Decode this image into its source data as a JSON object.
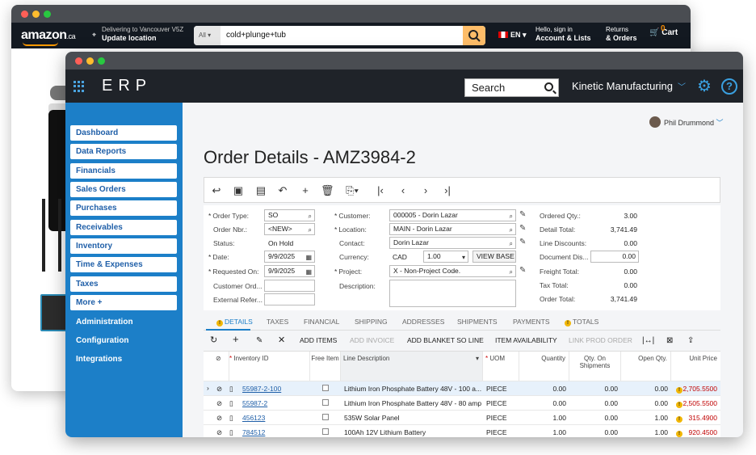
{
  "amazon": {
    "logo": "amazon",
    "logo_suffix": ".ca",
    "deliver_line1": "Delivering to Vancouver V5Z",
    "deliver_line2": "Update location",
    "search_scope": "All",
    "search_query": "cold+plunge+tub",
    "language": "EN",
    "account_line1": "Hello, sign in",
    "account_line2": "Account & Lists",
    "orders_line1": "Returns",
    "orders_line2": "& Orders",
    "cart_count": "0",
    "cart_label": "Cart"
  },
  "erp": {
    "brand": "ERP",
    "search_placeholder": "Search",
    "company": "Kinetic Manufacturing",
    "user": "Phil Drummond",
    "page_title": "Order Details - AMZ3984-2",
    "nav": [
      "Dashboard",
      "Data Reports",
      "Financials",
      "Sales Orders",
      "Purchases",
      "Receivables",
      "Inventory",
      "Time & Expenses",
      "Taxes",
      "More +"
    ],
    "nav_plain": [
      "Administration",
      "Configuration",
      "Integrations"
    ],
    "form": {
      "order_type_label": "Order Type:",
      "order_type": "SO",
      "order_nbr_label": "Order Nbr.:",
      "order_nbr": "<NEW>",
      "status_label": "Status:",
      "status": "On Hold",
      "date_label": "Date:",
      "date": "9/9/2025",
      "requested_on_label": "Requested On:",
      "requested_on": "9/9/2025",
      "customer_ord_label": "Customer Ord...",
      "external_ref_label": "External Refer...",
      "customer_label": "Customer:",
      "customer": "000005 - Dorin Lazar",
      "location_label": "Location:",
      "location": "MAIN - Dorin Lazar",
      "contact_label": "Contact:",
      "contact": "Dorin Lazar",
      "currency_label": "Currency:",
      "currency": "CAD",
      "rate": "1.00",
      "view_base": "VIEW BASE",
      "project_label": "Project:",
      "project": "X - Non-Project Code.",
      "description_label": "Description:",
      "ordered_qty_label": "Ordered Qty.:",
      "ordered_qty": "3.00",
      "detail_total_label": "Detail Total:",
      "detail_total": "3,741.49",
      "line_discounts_label": "Line Discounts:",
      "line_discounts": "0.00",
      "document_dis_label": "Document Dis...",
      "document_dis": "0.00",
      "freight_total_label": "Freight Total:",
      "freight_total": "0.00",
      "tax_total_label": "Tax Total:",
      "tax_total": "0.00",
      "order_total_label": "Order Total:",
      "order_total": "3,741.49"
    },
    "tabs": [
      "DETAILS",
      "TAXES",
      "FINANCIAL",
      "SHIPPING",
      "ADDRESSES",
      "SHIPMENTS",
      "PAYMENTS",
      "TOTALS"
    ],
    "grid_actions": [
      "ADD ITEMS",
      "ADD INVOICE",
      "ADD BLANKET SO LINE",
      "ITEM AVAILABILITY",
      "LINK PROD ORDER"
    ],
    "columns": [
      "Inventory ID",
      "Free Item",
      "Line Description",
      "UOM",
      "Quantity",
      "Qty. On Shipments",
      "Open Qty.",
      "Unit Price"
    ],
    "rows": [
      {
        "id": "55987-2-100",
        "desc": "Lithium Iron Phosphate Battery 48V - 100 a...",
        "uom": "PIECE",
        "qty": "0.00",
        "qty_ship": "0.00",
        "open": "0.00",
        "price": "2,705.5500"
      },
      {
        "id": "55987-2",
        "desc": "Lithium Iron Phosphate Battery 48V - 80 amp",
        "uom": "PIECE",
        "qty": "0.00",
        "qty_ship": "0.00",
        "open": "0.00",
        "price": "2,505.5500"
      },
      {
        "id": "456123",
        "desc": "535W Solar Panel",
        "uom": "PIECE",
        "qty": "1.00",
        "qty_ship": "0.00",
        "open": "1.00",
        "price": "315.4900"
      },
      {
        "id": "784512",
        "desc": "100Ah 12V Lithium Battery",
        "uom": "PIECE",
        "qty": "1.00",
        "qty_ship": "0.00",
        "open": "1.00",
        "price": "920.4500"
      }
    ]
  }
}
